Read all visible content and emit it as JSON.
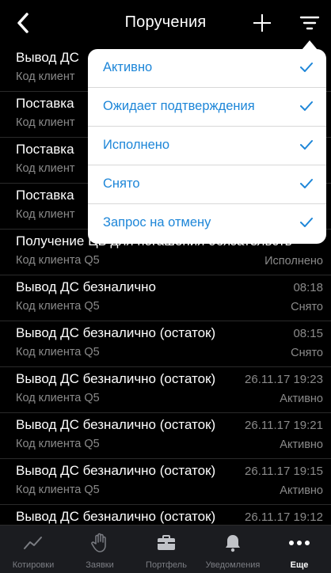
{
  "header": {
    "title": "Поручения"
  },
  "orders": [
    {
      "title": "Вывод ДС",
      "subtitle": "Код клиент",
      "time": "",
      "status": ""
    },
    {
      "title": "Поставка",
      "subtitle": "Код клиент",
      "time": "",
      "status": ""
    },
    {
      "title": "Поставка",
      "subtitle": "Код клиент",
      "time": "",
      "status": ""
    },
    {
      "title": "Поставка",
      "subtitle": "Код клиент",
      "time": "",
      "status": ""
    },
    {
      "title": "Получение ЦБ для погашения обязательств",
      "subtitle": "Код клиента Q5",
      "time": "",
      "status": "Исполнено"
    },
    {
      "title": "Вывод ДС безналично",
      "subtitle": "Код клиента Q5",
      "time": "08:18",
      "status": "Снято"
    },
    {
      "title": "Вывод ДС безналично (остаток)",
      "subtitle": "Код клиента Q5",
      "time": "08:15",
      "status": "Снято"
    },
    {
      "title": "Вывод ДС безналично (остаток)",
      "subtitle": "Код клиента Q5",
      "time": "26.11.17 19:23",
      "status": "Активно"
    },
    {
      "title": "Вывод ДС безналично (остаток)",
      "subtitle": "Код клиента Q5",
      "time": "26.11.17 19:21",
      "status": "Активно"
    },
    {
      "title": "Вывод ДС безналично (остаток)",
      "subtitle": "Код клиента Q5",
      "time": "26.11.17 19:15",
      "status": "Активно"
    },
    {
      "title": "Вывод ДС безналично (остаток)",
      "subtitle": "",
      "time": "26.11.17 19:12",
      "status": ""
    }
  ],
  "filter_menu": {
    "items": [
      {
        "label": "Активно",
        "checked": true
      },
      {
        "label": "Ожидает подтверждения",
        "checked": true
      },
      {
        "label": "Исполнено",
        "checked": true
      },
      {
        "label": "Снято",
        "checked": true
      },
      {
        "label": "Запрос на отмену",
        "checked": true
      }
    ]
  },
  "tabbar": {
    "tabs": [
      {
        "label": "Котировки",
        "icon": "chart-line-icon"
      },
      {
        "label": "Заявки",
        "icon": "hand-icon"
      },
      {
        "label": "Портфель",
        "icon": "briefcase-icon"
      },
      {
        "label": "Уведомления",
        "icon": "bell-icon"
      },
      {
        "label": "Еще",
        "icon": "more-dots-icon"
      }
    ],
    "active_index": 4
  },
  "colors": {
    "accent": "#1d86d8",
    "background": "#000000",
    "tabbar": "#1b1c20",
    "muted_text": "#8a8a8a"
  }
}
